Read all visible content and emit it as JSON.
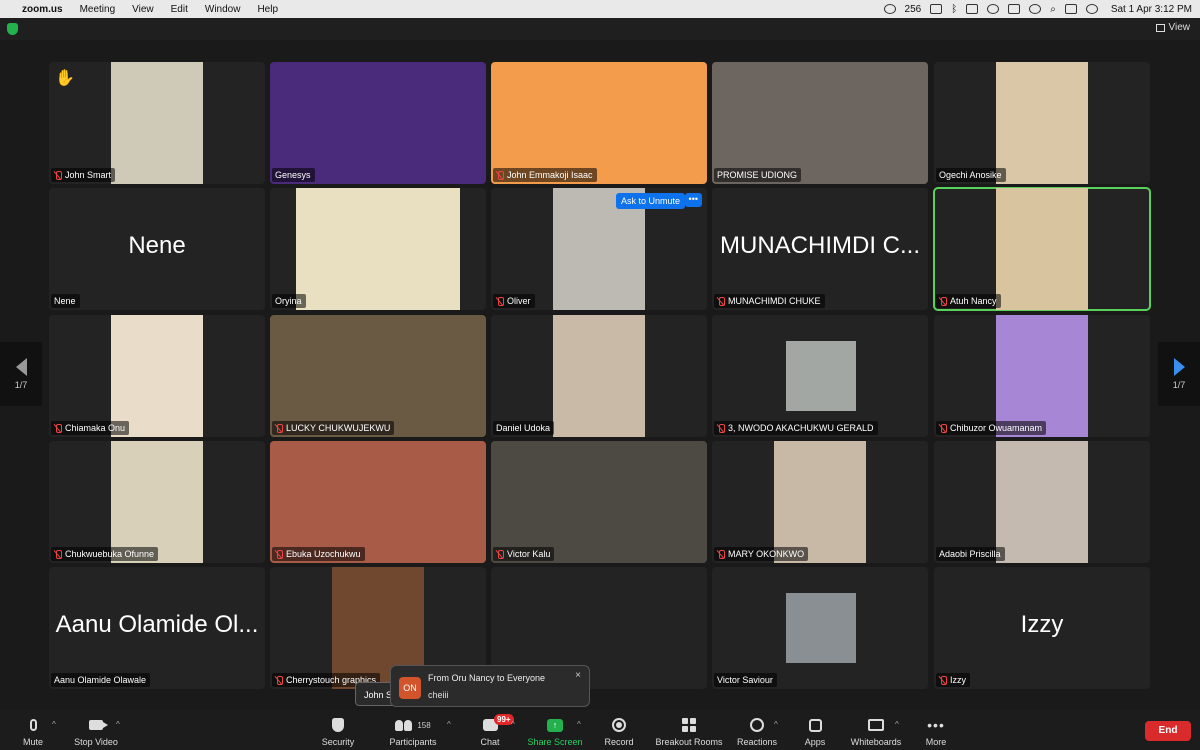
{
  "menubar": {
    "app": "zoom.us",
    "menus": [
      "Meeting",
      "View",
      "Edit",
      "Window",
      "Help"
    ],
    "status_badge": "256",
    "datetime": "Sat 1 Apr  3:12 PM"
  },
  "window": {
    "view_label": "View"
  },
  "pagination": {
    "left": "1/7",
    "right": "1/7"
  },
  "tiles": [
    {
      "name": "John Smart",
      "muted": true,
      "hand": true
    },
    {
      "name": "Genesys",
      "muted": false
    },
    {
      "name": "John Emmakoji Isaac",
      "muted": true
    },
    {
      "name": "PROMISE UDIONG",
      "muted": false
    },
    {
      "name": "Ogechi Anosike",
      "muted": false
    },
    {
      "name": "Nene",
      "big": "Nene",
      "muted": false
    },
    {
      "name": "Oryina",
      "muted": false
    },
    {
      "name": "Oliver",
      "muted": true,
      "ask_unmute": "Ask to Unmute",
      "more": "•••"
    },
    {
      "name": "MUNACHIMDI CHUKE",
      "big": "MUNACHIMDI C...",
      "muted": true
    },
    {
      "name": "Atuh Nancy",
      "muted": true,
      "active": true
    },
    {
      "name": "Chiamaka Onu",
      "muted": true
    },
    {
      "name": "LUCKY CHUKWUJEKWU",
      "muted": true
    },
    {
      "name": "Daniel Udoka",
      "muted": false
    },
    {
      "name": "3, NWODO AKACHUKWU GERALD",
      "muted": true
    },
    {
      "name": "Chibuzor Owuamanam",
      "muted": true
    },
    {
      "name": "Chukwuebuka Ofunne",
      "muted": true
    },
    {
      "name": "Ebuka Uzochukwu",
      "muted": true
    },
    {
      "name": "Victor Kalu",
      "muted": true
    },
    {
      "name": "MARY OKONKWO",
      "muted": true
    },
    {
      "name": "Adaobi Priscilla",
      "muted": false
    },
    {
      "name": "Aanu Olamide Olawale",
      "big": "Aanu Olamide Ol...",
      "muted": false
    },
    {
      "name": "Cherrystouch graphics",
      "muted": true
    },
    {
      "name": "",
      "muted": false
    },
    {
      "name": "Victor Saviour",
      "muted": false
    },
    {
      "name": "Izzy",
      "big": "Izzy",
      "muted": true
    }
  ],
  "chat": {
    "under_label": "John S",
    "avatar": "ON",
    "from": "From Oru Nancy to Everyone",
    "message": "cheiii",
    "close": "×"
  },
  "toolbar": {
    "mute": "Mute",
    "stop_video": "Stop Video",
    "security": "Security",
    "participants": "Participants",
    "participants_count": "158",
    "chat": "Chat",
    "chat_badge": "99+",
    "share_screen": "Share Screen",
    "record": "Record",
    "breakout_rooms": "Breakout Rooms",
    "reactions": "Reactions",
    "apps": "Apps",
    "whiteboards": "Whiteboards",
    "more": "More",
    "end": "End"
  },
  "colors": {
    "accent_blue": "#0e72ed",
    "active_speaker": "#5ad15a",
    "end_red": "#d92b2b",
    "share_green": "#23b14d"
  }
}
